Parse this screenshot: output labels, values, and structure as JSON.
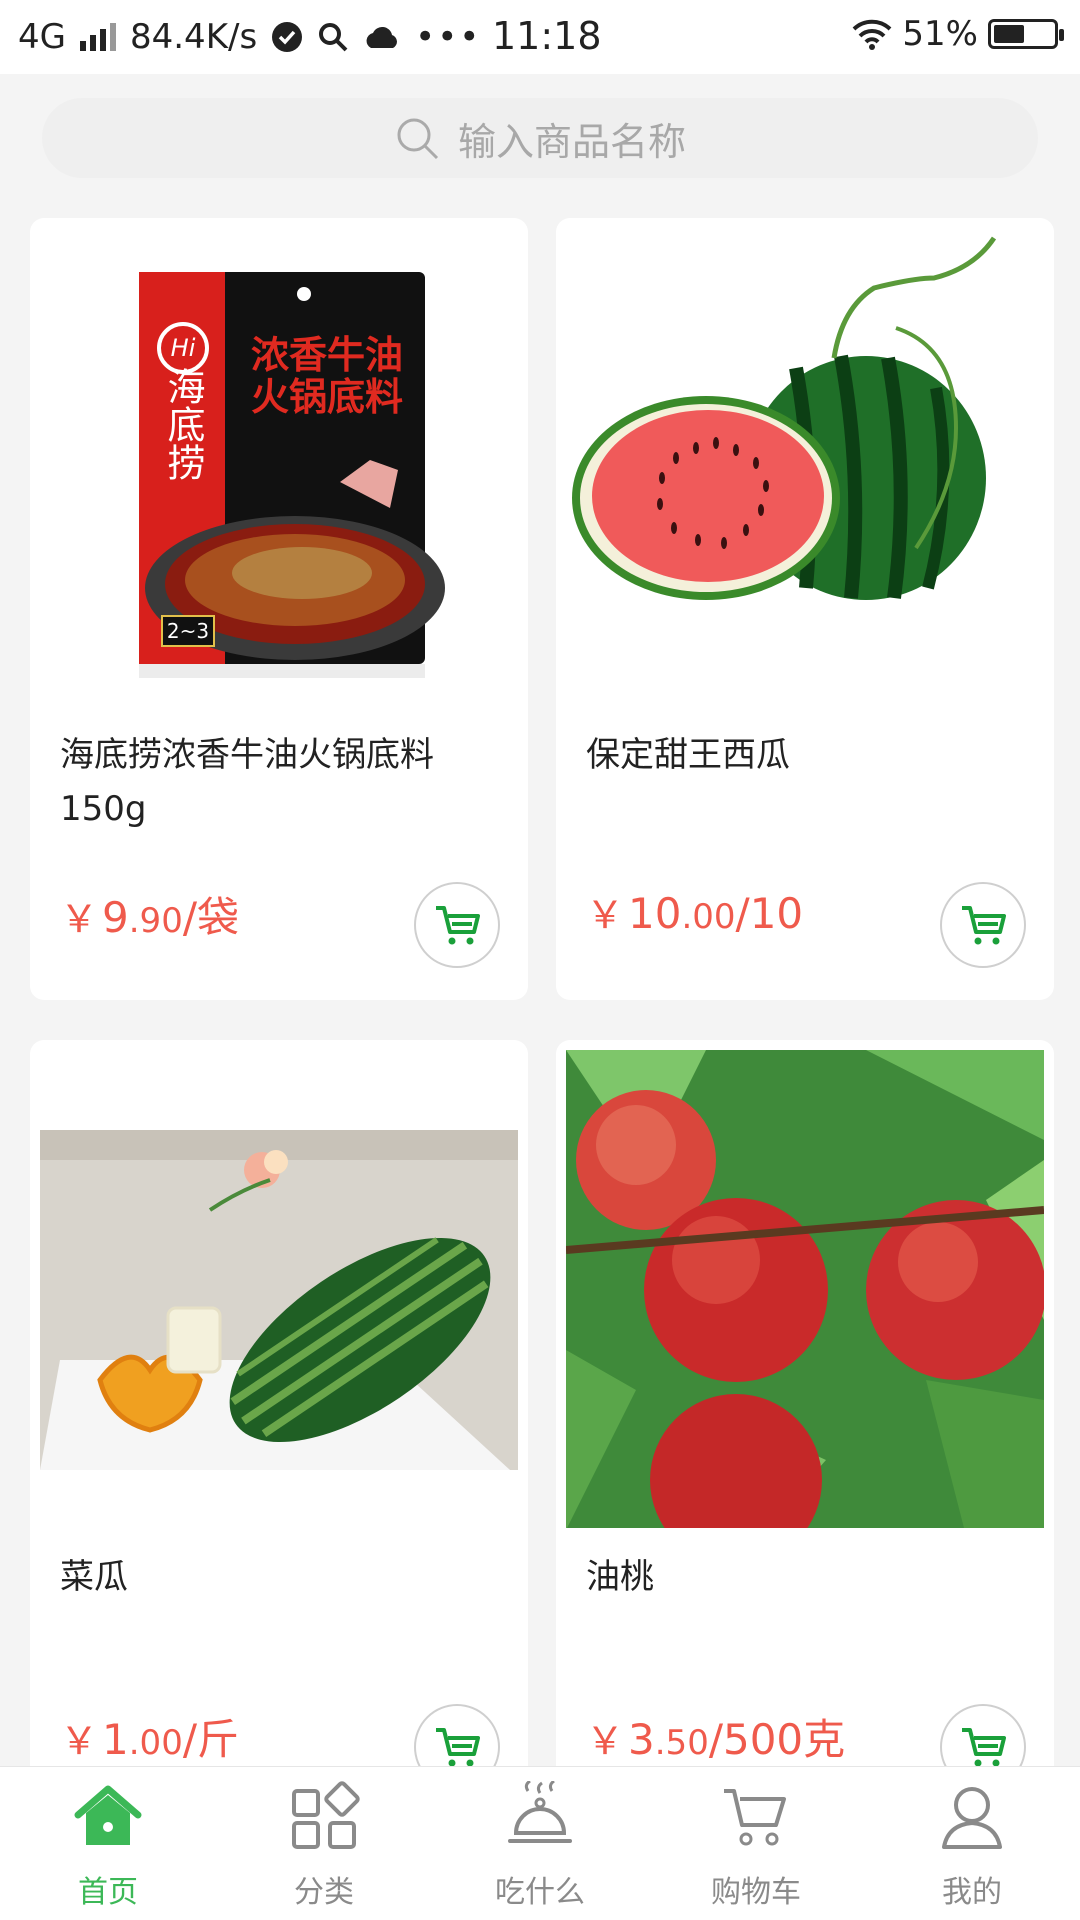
{
  "status_bar": {
    "network": "4G",
    "speed": "84.4K/s",
    "time": "11:18",
    "battery_text": "51%",
    "battery_level": 0.51
  },
  "search": {
    "placeholder": "输入商品名称"
  },
  "products": [
    {
      "name": "海底捞浓香牛油火锅底料150g",
      "price_yen": "￥",
      "price_int": "9",
      "price_dec": ".90",
      "unit": "/袋"
    },
    {
      "name": "保定甜王西瓜",
      "price_yen": "￥",
      "price_int": "10",
      "price_dec": ".00",
      "unit": "/10"
    },
    {
      "name": "菜瓜",
      "price_yen": "￥",
      "price_int": "1",
      "price_dec": ".00",
      "unit": "/斤"
    },
    {
      "name": "油桃",
      "price_yen": "￥",
      "price_int": "3",
      "price_dec": ".50",
      "unit": "/500克"
    }
  ],
  "hotpot_package": {
    "brand_logo": "Hi",
    "brand": "海底捞",
    "title_line1": "浓香牛油",
    "title_line2": "火锅底料",
    "serving": "2~3"
  },
  "nav": [
    {
      "label": "首页",
      "icon": "home-icon",
      "active": true
    },
    {
      "label": "分类",
      "icon": "category-icon",
      "active": false
    },
    {
      "label": "吃什么",
      "icon": "dish-cover-icon",
      "active": false
    },
    {
      "label": "购物车",
      "icon": "cart-icon",
      "active": false
    },
    {
      "label": "我的",
      "icon": "user-icon",
      "active": false
    }
  ],
  "colors": {
    "accent": "#3cb857",
    "price": "#ef5a4c",
    "cart_icon": "#1aa03a"
  }
}
